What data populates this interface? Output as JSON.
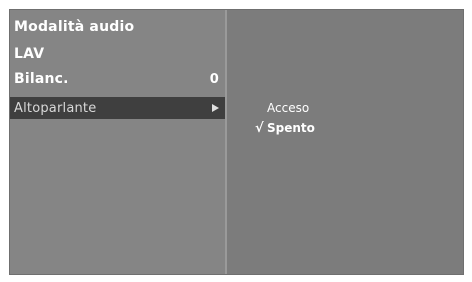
{
  "menu": {
    "items": [
      {
        "label": "Modalità audio",
        "value": ""
      },
      {
        "label": "LAV",
        "value": ""
      },
      {
        "label": "Bilanc.",
        "value": "0"
      },
      {
        "label": "Altoparlante",
        "value": ""
      }
    ],
    "selected_index": 3
  },
  "submenu": {
    "options": [
      {
        "label": "Acceso",
        "checked": false,
        "check_mark": ""
      },
      {
        "label": "Spento",
        "checked": true,
        "check_mark": "√"
      }
    ]
  },
  "colors": {
    "panel_bg": "#858585",
    "submenu_bg": "#7c7c7c",
    "highlight_bg": "#3f3f3f",
    "text": "#ffffff"
  }
}
